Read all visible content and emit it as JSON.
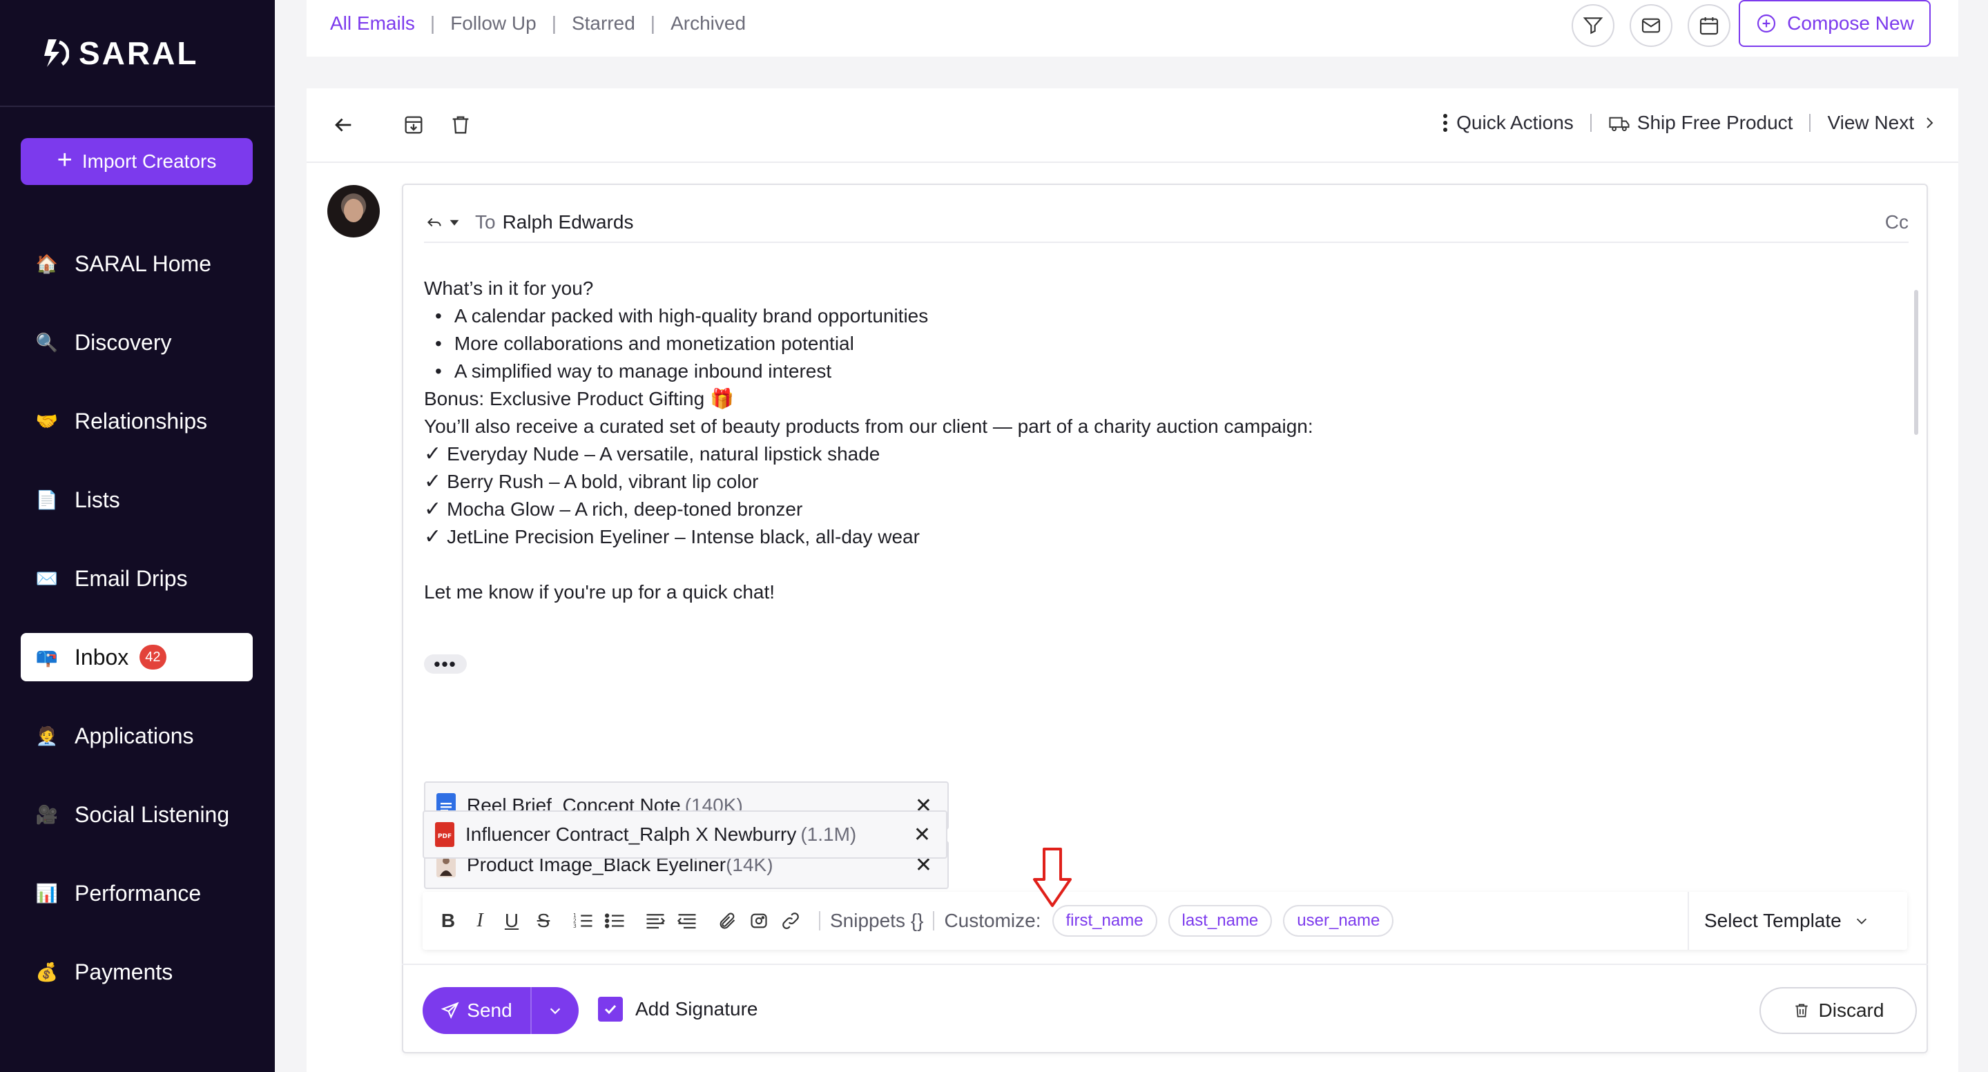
{
  "brand": {
    "name": "SARAL",
    "accent": "#7c3aed"
  },
  "sidebar": {
    "import_label": "Import Creators",
    "items": [
      {
        "label": "SARAL Home",
        "icon": "house-icon"
      },
      {
        "label": "Discovery",
        "icon": "magnifier-icon"
      },
      {
        "label": "Relationships",
        "icon": "handshake-icon"
      },
      {
        "label": "Lists",
        "icon": "document-icon"
      },
      {
        "label": "Email Drips",
        "icon": "envelope-icon"
      },
      {
        "label": "Inbox",
        "icon": "mailbox-icon",
        "badge": "42",
        "active": true
      },
      {
        "label": "Applications",
        "icon": "person-icon"
      },
      {
        "label": "Social Listening",
        "icon": "camera-icon"
      },
      {
        "label": "Performance",
        "icon": "bar-chart-icon"
      },
      {
        "label": "Payments",
        "icon": "money-bag-icon"
      }
    ]
  },
  "topbar": {
    "tabs": [
      "All Emails",
      "Follow Up",
      "Starred",
      "Archived"
    ],
    "compose_label": "Compose New"
  },
  "toolbar": {
    "quick_actions": "Quick Actions",
    "ship_free_product": "Ship Free Product",
    "view_next": "View Next"
  },
  "email": {
    "to_label": "To",
    "recipient": "Ralph Edwards",
    "cc_label": "Cc",
    "intro": "What’s in it for you?",
    "bullets": [
      "A calendar packed with high-quality brand opportunities",
      "More collaborations and monetization potential",
      "A simplified way to manage inbound interest"
    ],
    "bonus": "Bonus: Exclusive Product Gifting",
    "curated": "You’ll also receive a curated set of beauty products from our client — part of a charity auction campaign:",
    "products": [
      "Everyday Nude – A versatile, natural lipstick shade",
      "Berry Rush – A bold, vibrant lip color",
      "Mocha Glow – A rich, deep-toned bronzer",
      "JetLine Precision Eyeliner – Intense black, all-day wear"
    ],
    "closing": "Let me know if you're up for a quick chat!"
  },
  "attachments": [
    {
      "name": "Reel Brief_Concept Note",
      "size": "(140K)",
      "type": "doc"
    },
    {
      "name": "Product Image_Black Eyeliner",
      "size": "(14K)",
      "type": "image"
    },
    {
      "name": "Influencer Contract_Ralph X Newburry",
      "size": "(1.1M)",
      "type": "pdf"
    }
  ],
  "formatting": {
    "snippets_label": "Snippets {}",
    "customize_label": "Customize:",
    "chips": [
      "first_name",
      "last_name",
      "user_name"
    ],
    "template_label": "Select Template"
  },
  "footer": {
    "send_label": "Send",
    "signature_label": "Add Signature",
    "discard_label": "Discard"
  }
}
